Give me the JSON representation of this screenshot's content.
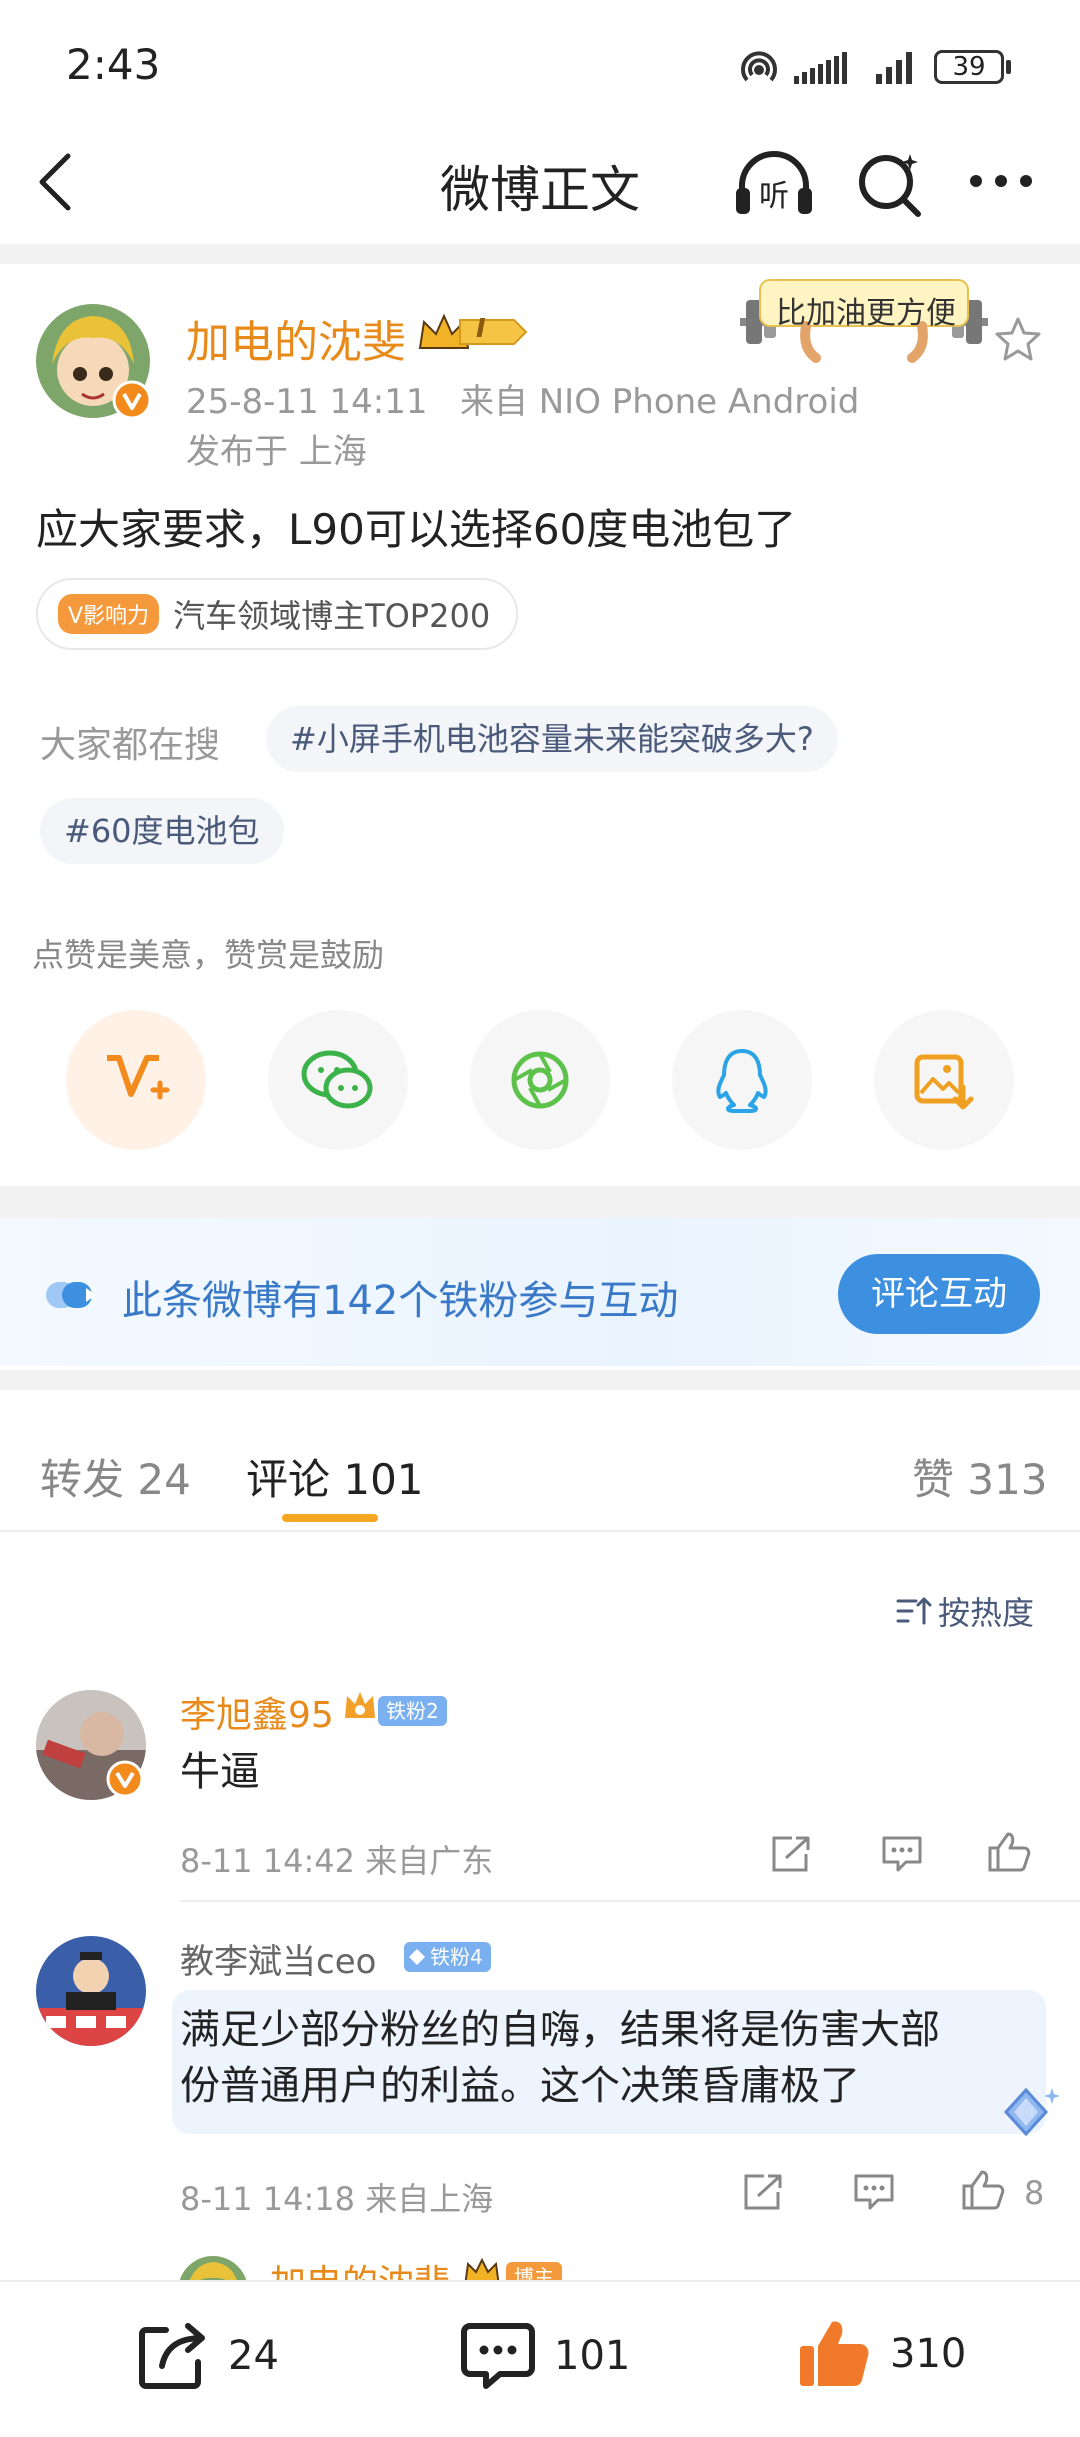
{
  "status_bar": {
    "time": "2:43",
    "battery": "39"
  },
  "nav": {
    "title": "微博正文"
  },
  "post": {
    "author": "加电的沈斐",
    "level_badge": "I",
    "sticker_text": "比加油更方便",
    "timestamp": "25-8-11 14:11",
    "source": "来自 NIO Phone Android",
    "location": "发布于 上海",
    "text": "应大家要求，L90可以选择60度电池包了",
    "influence": {
      "badge": "V影响力",
      "text": "汽车领域博主TOP200"
    },
    "search": {
      "label": "大家都在搜",
      "topics": [
        "#小屏手机电池容量未来能突破多大?",
        "#60度电池包"
      ]
    },
    "reward_tip": "点赞是美意，赞赏是鼓励"
  },
  "fans_banner": {
    "text": "此条微博有142个铁粉参与互动",
    "button": "评论互动"
  },
  "tabs": {
    "repost": "转发 24",
    "comment": "评论 101",
    "like": "赞 313"
  },
  "sort": {
    "label": "按热度"
  },
  "comments": [
    {
      "name": "李旭鑫95",
      "badge": "铁粉2",
      "text": "牛逼",
      "meta": "8-11 14:42  来自广东",
      "likes": ""
    },
    {
      "name": "教李斌当ceo",
      "badge": "铁粉4",
      "text_line1": "满足少部分粉丝的自嗨，结果将是伤害大部",
      "text_line2": "份普通用户的利益。这个决策昏庸极了",
      "meta": "8-11 14:18  来自上海",
      "likes": "8"
    },
    {
      "name": "加电的沈斐",
      "badge": "博主"
    }
  ],
  "bottom_bar": {
    "repost": "24",
    "comment": "101",
    "like": "310"
  },
  "colors": {
    "accent_orange": "#e88a1a",
    "link_blue": "#3a78c8",
    "button_blue": "#3d8fe0",
    "like_orange": "#f07a2a"
  }
}
